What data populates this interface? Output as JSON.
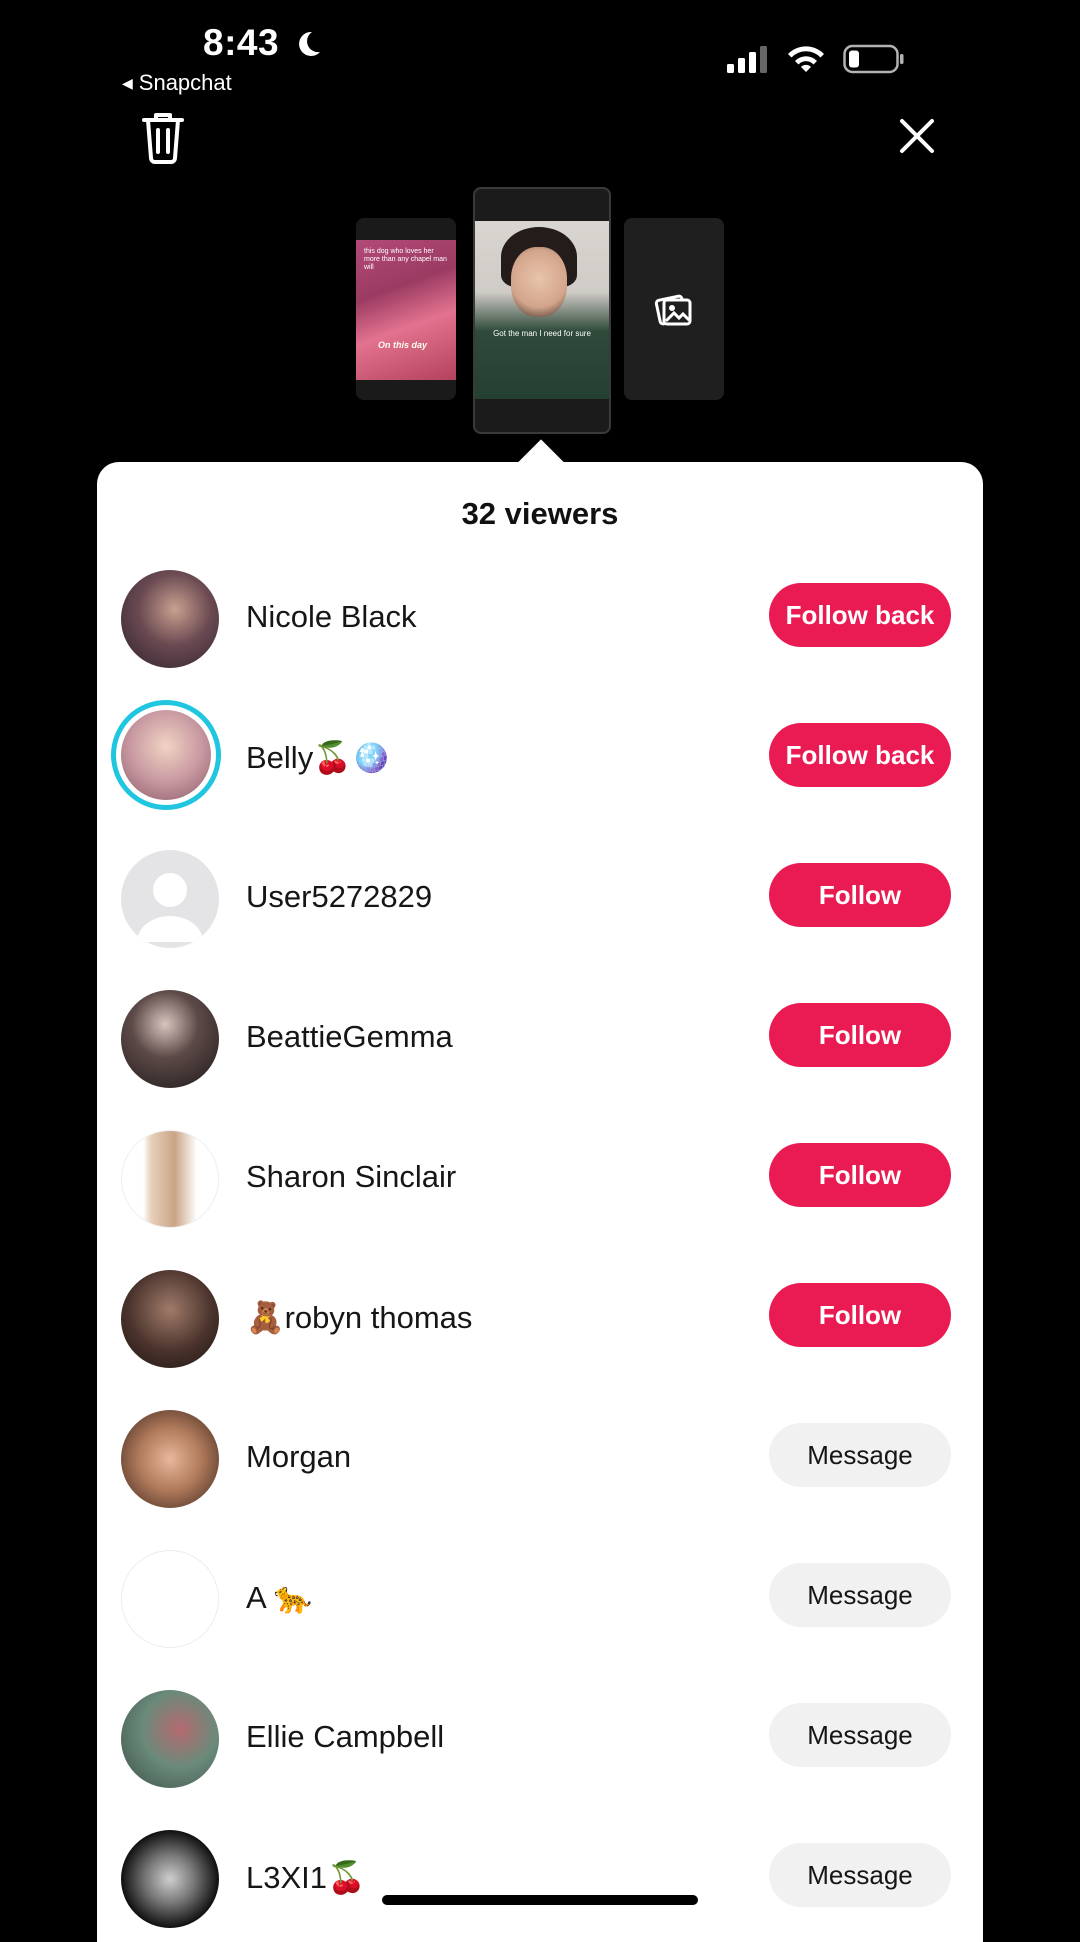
{
  "status_bar": {
    "time": "8:43",
    "back_app": "Snapchat",
    "icons": [
      "moon-icon",
      "signal-icon",
      "wifi-icon",
      "battery-icon"
    ]
  },
  "top_actions": {
    "delete_icon": "trash-icon",
    "close_icon": "close-icon"
  },
  "stories": {
    "left_caption_top": "this dog who loves her more than any chapel man will",
    "left_caption_bottom": "On this day",
    "center_caption": "Got the man I need for sure",
    "add_icon": "add-photo-icon"
  },
  "viewers": {
    "title": "32 viewers",
    "list": [
      {
        "name": "Nicole Black",
        "action": "Follow back",
        "style": "primary"
      },
      {
        "name": "Belly🍒🪩",
        "action": "Follow back",
        "style": "primary"
      },
      {
        "name": "User5272829",
        "action": "Follow",
        "style": "primary"
      },
      {
        "name": "BeattieGemma",
        "action": "Follow",
        "style": "primary"
      },
      {
        "name": "Sharon Sinclair",
        "action": "Follow",
        "style": "primary"
      },
      {
        "name": "🧸robyn thomas",
        "action": "Follow",
        "style": "primary"
      },
      {
        "name": "Morgan",
        "action": "Message",
        "style": "secondary"
      },
      {
        "name": "A 🐆",
        "action": "Message",
        "style": "secondary"
      },
      {
        "name": "Ellie Campbell",
        "action": "Message",
        "style": "secondary"
      },
      {
        "name": "L3XI1🍒",
        "action": "Message",
        "style": "secondary"
      }
    ]
  },
  "colors": {
    "accent": "#ea1a52",
    "ring": "#20c6e0",
    "secondary_button": "#f1f1f2"
  }
}
